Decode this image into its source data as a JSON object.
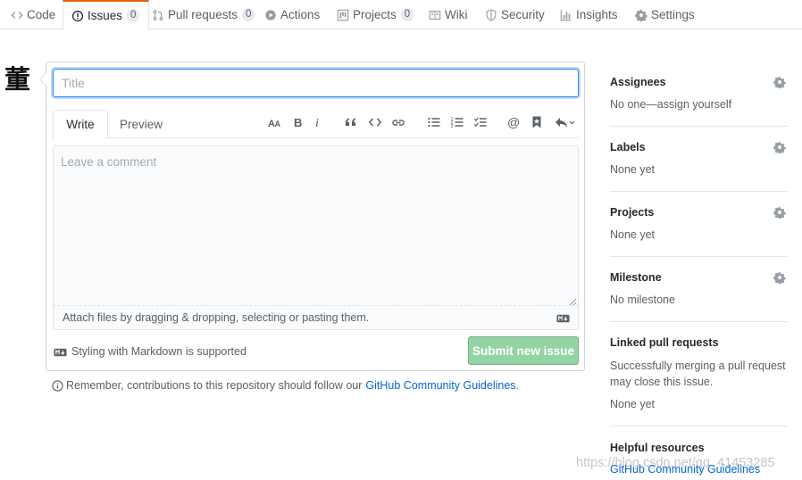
{
  "reponav": {
    "tabs": [
      {
        "label": "Code",
        "icon": "code-icon"
      },
      {
        "label": "Issues",
        "count": "0",
        "icon": "issue-opened-icon",
        "selected": true
      },
      {
        "label": "Pull requests",
        "count": "0",
        "icon": "git-pull-request-icon"
      },
      {
        "label": "Actions",
        "icon": "play-icon"
      },
      {
        "label": "Projects",
        "count": "0",
        "icon": "project-icon"
      },
      {
        "label": "Wiki",
        "icon": "book-icon"
      },
      {
        "label": "Security",
        "icon": "shield-icon"
      },
      {
        "label": "Insights",
        "icon": "graph-icon"
      },
      {
        "label": "Settings",
        "icon": "gear-icon"
      }
    ],
    "accent_color": "#e36209"
  },
  "avatar": {
    "glyph": "董"
  },
  "issue_form": {
    "title_placeholder": "Title",
    "title_value": "",
    "write_tab": "Write",
    "preview_tab": "Preview",
    "toolbar": [
      "text-size-icon",
      "bold-icon",
      "italic-icon",
      "quote-icon",
      "code-icon",
      "link-icon",
      "unordered-list-icon",
      "ordered-list-icon",
      "task-list-icon",
      "mention-icon",
      "bookmark-icon",
      "reply-icon"
    ],
    "comment_placeholder": "Leave a comment",
    "attach_text": "Attach files by dragging & dropping, selecting or pasting them.",
    "markdown_note": "Styling with Markdown is supported",
    "submit_label": "Submit new issue",
    "submit_color": "#94d3a2"
  },
  "guidelines": {
    "text": "Remember, contributions to this repository should follow our",
    "link": "GitHub Community Guidelines",
    "trailing": "."
  },
  "sidebar": {
    "assignees": {
      "heading": "Assignees",
      "value": "No one—assign yourself"
    },
    "labels": {
      "heading": "Labels",
      "value": "None yet"
    },
    "projects": {
      "heading": "Projects",
      "value": "None yet"
    },
    "milestone": {
      "heading": "Milestone",
      "value": "No milestone"
    },
    "linked_prs": {
      "heading": "Linked pull requests",
      "line1": "Successfully merging a pull request",
      "line2": "may close this issue.",
      "value": "None yet"
    },
    "helpful": {
      "heading": "Helpful resources",
      "link": "GitHub Community Guidelines"
    }
  },
  "watermark": "https://blog.csdn.net/qq_41453285"
}
